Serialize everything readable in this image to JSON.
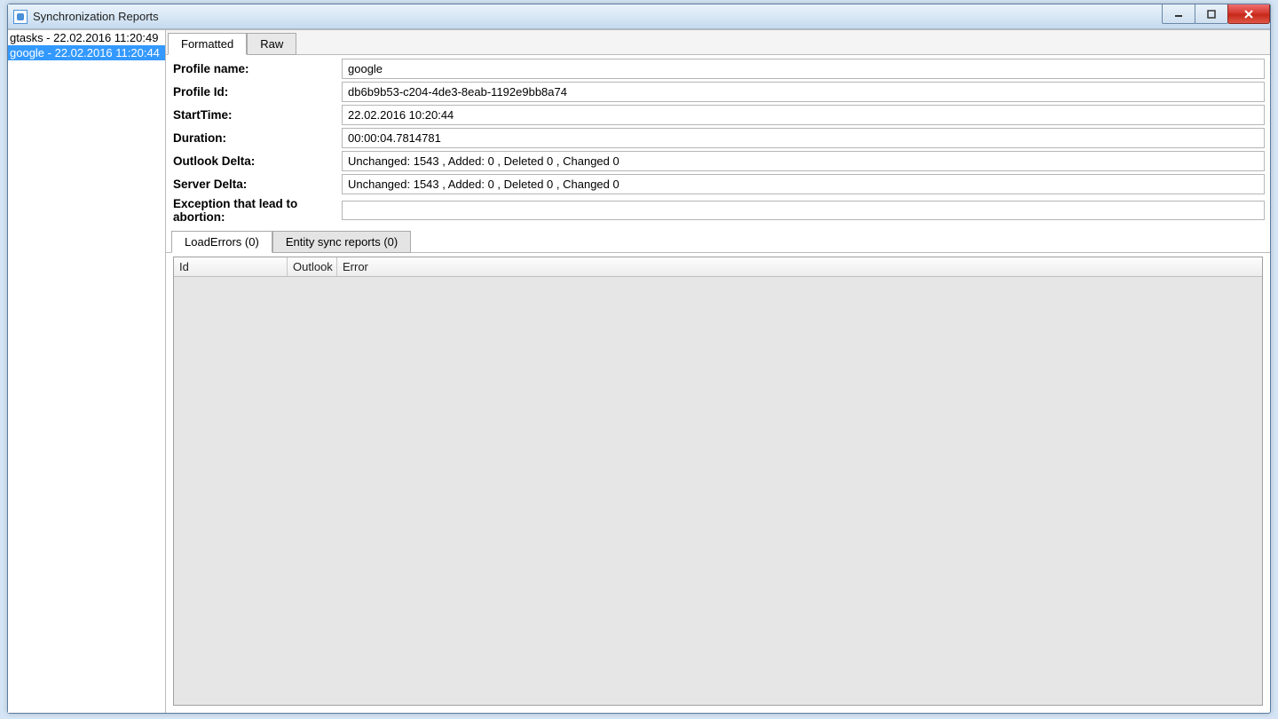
{
  "window": {
    "title": "Synchronization Reports"
  },
  "sidebar": {
    "items": [
      {
        "label": "gtasks - 22.02.2016 11:20:49",
        "selected": false
      },
      {
        "label": "google - 22.02.2016 11:20:44",
        "selected": true
      }
    ]
  },
  "tabs": {
    "formatted": "Formatted",
    "raw": "Raw"
  },
  "fields": {
    "profile_name_label": "Profile name:",
    "profile_name_value": "google",
    "profile_id_label": "Profile Id:",
    "profile_id_value": "db6b9b53-c204-4de3-8eab-1192e9bb8a74",
    "start_time_label": "StartTime:",
    "start_time_value": "22.02.2016 10:20:44",
    "duration_label": "Duration:",
    "duration_value": "00:00:04.7814781",
    "outlook_delta_label": "Outlook Delta:",
    "outlook_delta_value": "Unchanged: 1543 , Added: 0 , Deleted 0 ,  Changed 0",
    "server_delta_label": "Server Delta:",
    "server_delta_value": "Unchanged: 1543 , Added: 0 , Deleted 0 ,  Changed 0",
    "exception_label": "Exception that lead to abortion:",
    "exception_value": ""
  },
  "subtabs": {
    "load_errors": "LoadErrors (0)",
    "entity_reports": "Entity sync reports (0)"
  },
  "grid": {
    "columns": {
      "id": "Id",
      "outlook": "Outlook",
      "error": "Error"
    },
    "rows": []
  }
}
